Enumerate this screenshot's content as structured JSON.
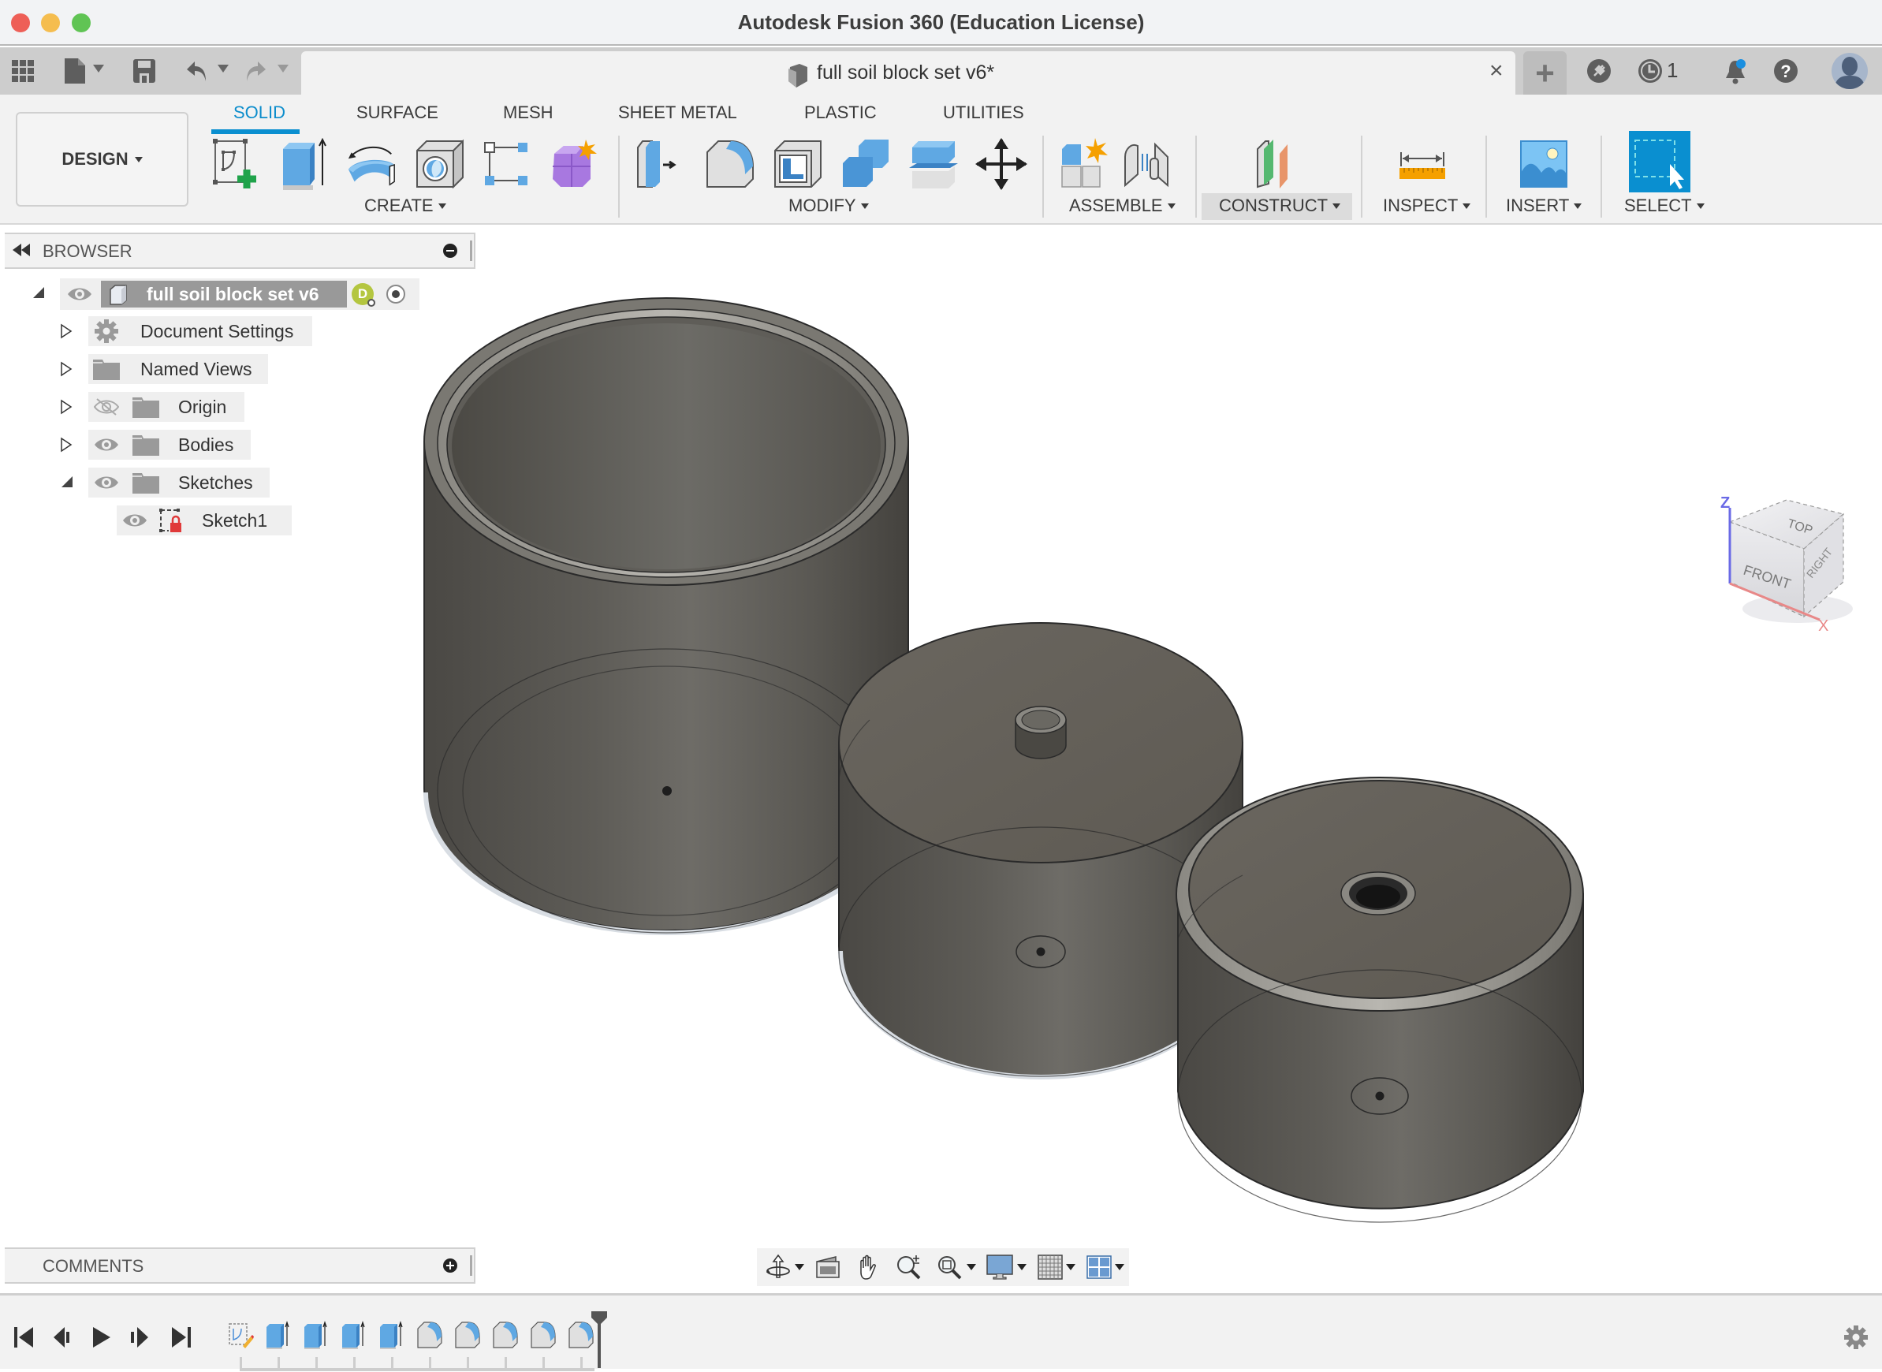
{
  "window": {
    "title": "Autodesk Fusion 360 (Education License)",
    "traffic_lights": {
      "close": "#ee5f57",
      "minimize": "#f5bd4f",
      "maximize": "#60c454"
    }
  },
  "tabbar": {
    "icons": [
      "apps-grid-icon",
      "file-icon",
      "save-icon",
      "undo-icon",
      "redo-icon"
    ],
    "document_tab": {
      "title": "full soil block set v6*",
      "icon": "component-icon",
      "close_label": "×"
    },
    "new_tab_label": "+",
    "right_icons": {
      "extensions": "plug-icon",
      "job_status_count": "1",
      "notifications": "bell-icon",
      "help": "help-icon",
      "profile": "user-avatar"
    }
  },
  "toolbar": {
    "workspace_button": "DESIGN",
    "workspace_tabs": [
      {
        "label": "SOLID",
        "active": true
      },
      {
        "label": "SURFACE",
        "active": false
      },
      {
        "label": "MESH",
        "active": false
      },
      {
        "label": "SHEET METAL",
        "active": false
      },
      {
        "label": "PLASTIC",
        "active": false
      },
      {
        "label": "UTILITIES",
        "active": false
      }
    ],
    "groups": [
      {
        "label": "CREATE",
        "tools": [
          "create-sketch",
          "extrude",
          "revolve",
          "hole",
          "pattern",
          "create-form"
        ]
      },
      {
        "label": "MODIFY",
        "tools": [
          "press-pull",
          "fillet",
          "shell",
          "combine",
          "split-body",
          "move-copy"
        ]
      },
      {
        "label": "ASSEMBLE",
        "tools": [
          "new-component",
          "joint"
        ]
      },
      {
        "label": "CONSTRUCT",
        "tools": [
          "offset-plane"
        ],
        "highlighted": true
      },
      {
        "label": "INSPECT",
        "tools": [
          "measure"
        ]
      },
      {
        "label": "INSERT",
        "tools": [
          "insert-image"
        ]
      },
      {
        "label": "SELECT",
        "tools": [
          "window-select"
        ]
      }
    ],
    "accent_color": "#0a8fd0"
  },
  "browser": {
    "title": "BROWSER",
    "root": {
      "label": "full soil block set v6",
      "badge": "D"
    },
    "items": [
      {
        "label": "Document Settings",
        "icon": "gear-icon",
        "expanded": false,
        "visible": null
      },
      {
        "label": "Named Views",
        "icon": "folder-icon",
        "expanded": false,
        "visible": null
      },
      {
        "label": "Origin",
        "icon": "folder-icon",
        "expanded": false,
        "visible": false
      },
      {
        "label": "Bodies",
        "icon": "folder-icon",
        "expanded": false,
        "visible": true
      },
      {
        "label": "Sketches",
        "icon": "folder-icon",
        "expanded": true,
        "visible": true
      },
      {
        "label": "Sketch1",
        "icon": "sketch-locked-icon",
        "child": true,
        "visible": true
      }
    ]
  },
  "viewcube": {
    "top": "TOP",
    "front": "FRONT",
    "right": "RIGHT",
    "z_axis": "Z",
    "x_axis": "X"
  },
  "comments": {
    "title": "COMMENTS"
  },
  "navbar": {
    "items": [
      "orbit-icon",
      "look-at-icon",
      "pan-icon",
      "zoom-icon",
      "fit-icon",
      "display-settings-icon",
      "grid-icon",
      "viewports-icon"
    ]
  },
  "timeline": {
    "controls": [
      "first",
      "previous",
      "play",
      "next",
      "last"
    ],
    "features": [
      "sketch",
      "extrude",
      "extrude",
      "extrude",
      "extrude",
      "fillet",
      "fillet",
      "fillet",
      "fillet",
      "fillet"
    ]
  }
}
